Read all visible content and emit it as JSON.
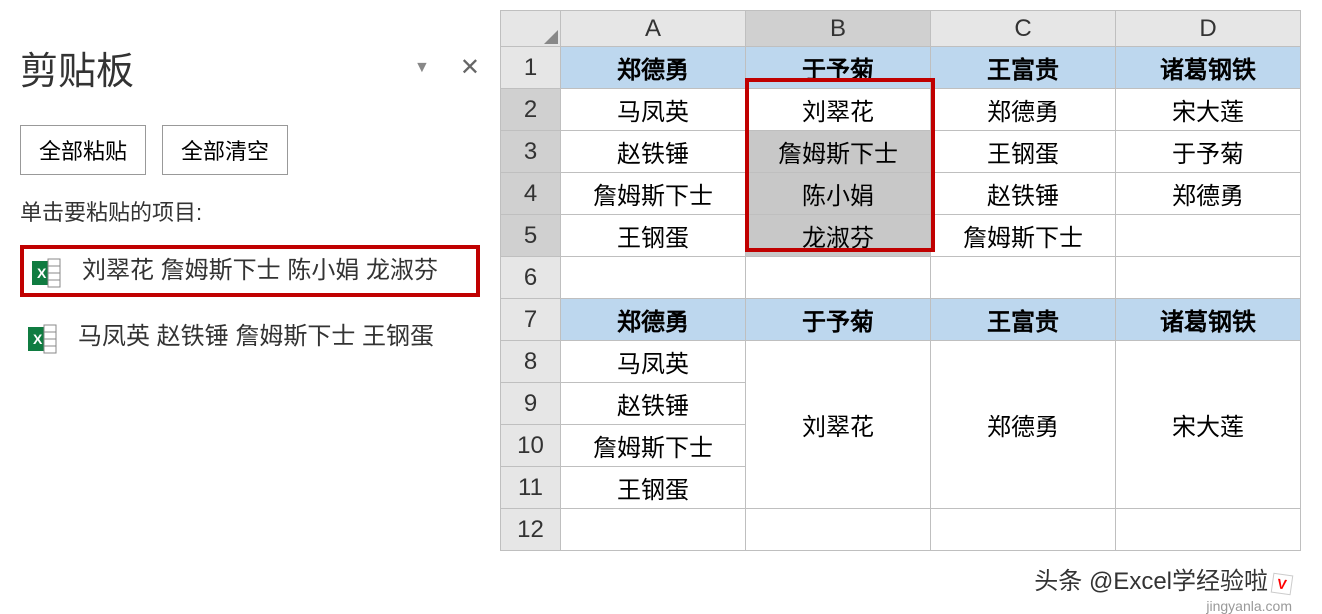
{
  "clipboard": {
    "title": "剪贴板",
    "paste_all_btn": "全部粘贴",
    "clear_all_btn": "全部清空",
    "hint": "单击要粘贴的项目:",
    "items": [
      {
        "text": "刘翠花 詹姆斯下士 陈小娟 龙淑芬",
        "highlighted": true
      },
      {
        "text": "马凤英 赵铁锤 詹姆斯下士 王钢蛋",
        "highlighted": false
      }
    ]
  },
  "spreadsheet": {
    "columns": [
      "A",
      "B",
      "C",
      "D"
    ],
    "selected_col": "B",
    "selected_rows": [
      2,
      3,
      4,
      5
    ],
    "rows": [
      {
        "num": 1,
        "cells": [
          "郑德勇",
          "于予菊",
          "王富贵",
          "诸葛钢铁"
        ],
        "header": true
      },
      {
        "num": 2,
        "cells": [
          "马凤英",
          "刘翠花",
          "郑德勇",
          "宋大莲"
        ]
      },
      {
        "num": 3,
        "cells": [
          "赵铁锤",
          "詹姆斯下士",
          "王钢蛋",
          "于予菊"
        ]
      },
      {
        "num": 4,
        "cells": [
          "詹姆斯下士",
          "陈小娟",
          "赵铁锤",
          "郑德勇"
        ]
      },
      {
        "num": 5,
        "cells": [
          "王钢蛋",
          "龙淑芬",
          "詹姆斯下士",
          ""
        ]
      },
      {
        "num": 6,
        "cells": [
          "",
          "",
          "",
          ""
        ]
      },
      {
        "num": 7,
        "cells": [
          "郑德勇",
          "于予菊",
          "王富贵",
          "诸葛钢铁"
        ],
        "header": true
      },
      {
        "num": 8,
        "cells": [
          "马凤英",
          "",
          "",
          ""
        ]
      },
      {
        "num": 9,
        "cells": [
          "赵铁锤",
          "",
          "",
          ""
        ]
      },
      {
        "num": 10,
        "cells": [
          "詹姆斯下士",
          "",
          "",
          ""
        ]
      },
      {
        "num": 11,
        "cells": [
          "王钢蛋",
          "",
          "",
          ""
        ]
      },
      {
        "num": 12,
        "cells": [
          "",
          "",
          "",
          ""
        ]
      }
    ],
    "merged": {
      "B8_11": "刘翠花",
      "C8_11": "郑德勇",
      "D8_11": "宋大莲"
    }
  },
  "watermark": {
    "text": "头条 @Excel学经验啦",
    "sub": "jingyanla.com"
  }
}
